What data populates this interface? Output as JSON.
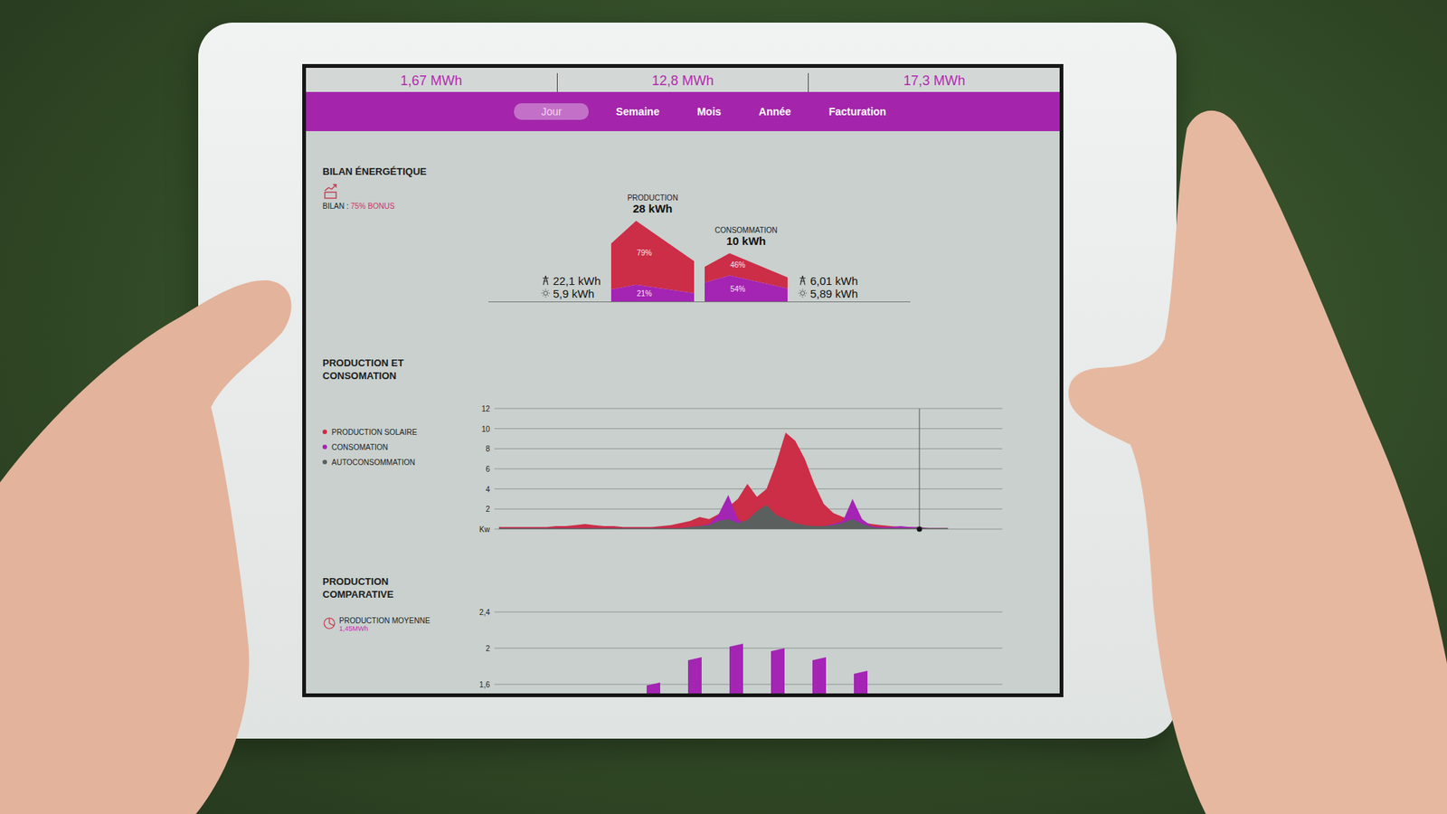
{
  "top_stats": [
    "1,67 MWh",
    "12,8 MWh",
    "17,3 MWh"
  ],
  "tabs": [
    {
      "label": "Jour",
      "selected": true
    },
    {
      "label": "Semaine",
      "selected": false
    },
    {
      "label": "Mois",
      "selected": false
    },
    {
      "label": "Année",
      "selected": false
    },
    {
      "label": "Facturation",
      "selected": false
    }
  ],
  "bilan": {
    "title": "BILAN ÉNERGÉTIQUE",
    "summary_label": "BILAN : ",
    "summary_value": "75% BONUS",
    "production": {
      "label": "PRODUCTION",
      "value": "28 kWh",
      "total": 28,
      "grid": "22,1 kWh",
      "solar": "5,9 kWh",
      "shares": [
        {
          "label": "79%",
          "share": 0.79,
          "color": "#cc2d47"
        },
        {
          "label": "21%",
          "share": 0.21,
          "color": "#a424b3"
        }
      ]
    },
    "consumption": {
      "label": "CONSOMMATION",
      "value": "10 kWh",
      "total": 10,
      "grid": "6,01 kWh",
      "solar": "5,89 kWh",
      "shares": [
        {
          "label": "46%",
          "share": 0.46,
          "color": "#cc2d47"
        },
        {
          "label": "54%",
          "share": 0.54,
          "color": "#a424b3"
        }
      ]
    }
  },
  "power_chart": {
    "title": "PRODUCTION ET CONSOMATION",
    "ticks": [
      {
        "label": "12",
        "value": 12
      },
      {
        "label": "10",
        "value": 10
      },
      {
        "label": "8",
        "value": 8
      },
      {
        "label": "6",
        "value": 6
      },
      {
        "label": "4",
        "value": 4
      },
      {
        "label": "2",
        "value": 2
      },
      {
        "label": "Kw",
        "value": 0
      }
    ],
    "cursor_index": 44,
    "series": [
      {
        "name": "PRODUCTION SOLAIRE",
        "color": "#cc2d47",
        "values": [
          0.2,
          0.2,
          0.2,
          0.2,
          0.2,
          0.2,
          0.3,
          0.3,
          0.4,
          0.5,
          0.4,
          0.3,
          0.3,
          0.2,
          0.2,
          0.2,
          0.2,
          0.3,
          0.4,
          0.6,
          0.8,
          1.2,
          1.0,
          1.5,
          2.2,
          3.0,
          4.5,
          3.2,
          4.0,
          6.5,
          9.6,
          8.8,
          7.0,
          4.5,
          2.5,
          1.6,
          1.2,
          0.9,
          0.7,
          0.5,
          0.4,
          0.3,
          0.2,
          0.2,
          0.1,
          0.1,
          0.1,
          0.1
        ]
      },
      {
        "name": "CONSOMATION",
        "color": "#a424b3",
        "values": [
          0.1,
          0.1,
          0.1,
          0.1,
          0.1,
          0.1,
          0.1,
          0.1,
          0.1,
          0.1,
          0.1,
          0.1,
          0.1,
          0.1,
          0.1,
          0.1,
          0.1,
          0.1,
          0.1,
          0.1,
          0.2,
          0.3,
          0.5,
          1.5,
          3.4,
          1.0,
          0.3,
          0.2,
          0.2,
          0.2,
          0.2,
          0.2,
          0.2,
          0.2,
          0.3,
          0.5,
          0.8,
          3.0,
          1.0,
          0.3,
          0.2,
          0.2,
          0.3,
          0.2,
          0.2,
          0.1,
          0.1,
          0.1
        ]
      },
      {
        "name": "AUTOCONSOMMATION",
        "color": "#5b605f",
        "values": [
          0.1,
          0.1,
          0.1,
          0.1,
          0.1,
          0.1,
          0.1,
          0.1,
          0.1,
          0.1,
          0.1,
          0.1,
          0.1,
          0.1,
          0.1,
          0.1,
          0.1,
          0.1,
          0.1,
          0.1,
          0.2,
          0.3,
          0.4,
          0.8,
          1.0,
          0.6,
          0.9,
          1.8,
          2.4,
          1.4,
          1.0,
          0.6,
          0.4,
          0.3,
          0.3,
          0.4,
          0.6,
          1.0,
          0.5,
          0.2,
          0.1,
          0.1,
          0.1,
          0.1,
          0.1,
          0.1,
          0.1,
          0.1
        ]
      }
    ]
  },
  "comparison_chart": {
    "title": "PRODUCTION COMPARATIVE",
    "average_label": "PRODUCTION MOYENNE",
    "average_value": "1,45MWh",
    "ticks": [
      {
        "label": "2,4",
        "value": 2.4
      },
      {
        "label": "2",
        "value": 2
      },
      {
        "label": "1,6",
        "value": 1.6
      }
    ],
    "bars": [
      1.62,
      1.9,
      2.05,
      2.0,
      1.9,
      1.75
    ]
  }
}
